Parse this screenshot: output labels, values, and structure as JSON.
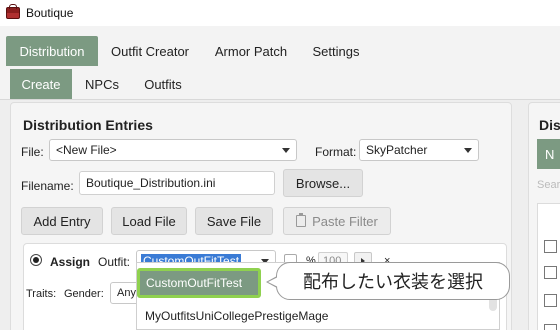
{
  "window": {
    "title": "Boutique"
  },
  "main_tabs": [
    {
      "label": "Distribution",
      "active": true
    },
    {
      "label": "Outfit Creator",
      "active": false
    },
    {
      "label": "Armor Patch",
      "active": false
    },
    {
      "label": "Settings",
      "active": false
    }
  ],
  "sub_tabs": [
    {
      "label": "Create",
      "active": true
    },
    {
      "label": "NPCs",
      "active": false
    },
    {
      "label": "Outfits",
      "active": false
    }
  ],
  "distribution": {
    "title": "Distribution Entries",
    "file_label": "File:",
    "file_value": "<New File>",
    "format_label": "Format:",
    "format_value": "SkyPatcher",
    "filename_label": "Filename:",
    "filename_value": "Boutique_Distribution.ini",
    "browse_label": "Browse...",
    "add_entry_label": "Add Entry",
    "load_file_label": "Load File",
    "save_file_label": "Save File",
    "paste_filter_label": "Paste Filter"
  },
  "entry": {
    "assign_label": "Assign",
    "outfit_label": "Outfit:",
    "outfit_value": "CustomOutFitTest",
    "percent_label": "%",
    "percent_value": "100",
    "remove_label": "×",
    "traits_label": "Traits:",
    "gender_label": "Gender:",
    "gender_value": "Any"
  },
  "dropdown": {
    "options": [
      "CustomOutFitTest",
      "MyOutfitsUniCollegePrestigeMage"
    ]
  },
  "callout": {
    "text": "配布したい衣装を選択"
  },
  "right_panel": {
    "title": "Dist",
    "tab_label": "N",
    "search_placeholder": "Searc"
  },
  "colors": {
    "accent": "#7c9a82",
    "highlight_border": "#8fd14f",
    "selection": "#3a7bd5"
  }
}
